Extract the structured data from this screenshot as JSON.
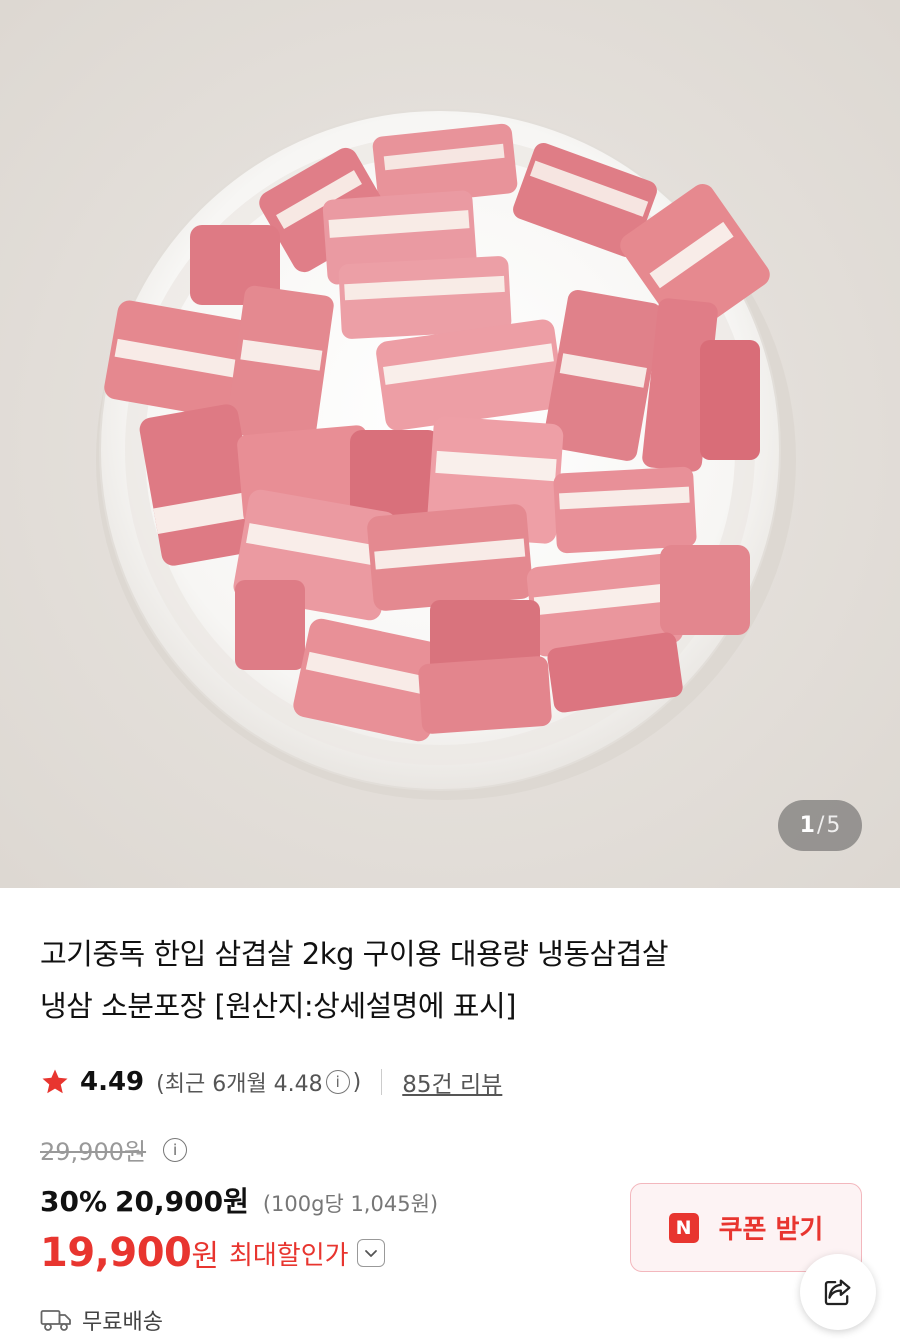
{
  "image_indicator": {
    "current": "1",
    "separator": "/",
    "total": "5"
  },
  "product": {
    "title_line1": "고기중독 한입 삼겹살 2kg 구이용 대용량 냉동삼겹살",
    "title_line2": "냉삼 소분포장 [원산지:상세설명에 표시]"
  },
  "rating": {
    "score": "4.49",
    "recent_prefix": "(최근 6개월 4.48",
    "recent_suffix": ")",
    "info_symbol": "i",
    "reviews": "85건 리뷰"
  },
  "price": {
    "original": "29,900원",
    "discount_pct": "30%",
    "sale": "20,900원",
    "unit": "(100g당 1,045원)",
    "final_number": "19,900",
    "final_won": "원",
    "max_discount_label": "최대할인가"
  },
  "coupon": {
    "badge": "N",
    "label": "쿠폰 받기"
  },
  "shipping": {
    "label": "무료배송"
  },
  "colors": {
    "accent_red": "#e8352f",
    "hero_bg": "#e8e4df"
  },
  "icons": [
    "star-icon",
    "info-icon",
    "chevron-down-icon",
    "share-icon",
    "truck-icon"
  ]
}
